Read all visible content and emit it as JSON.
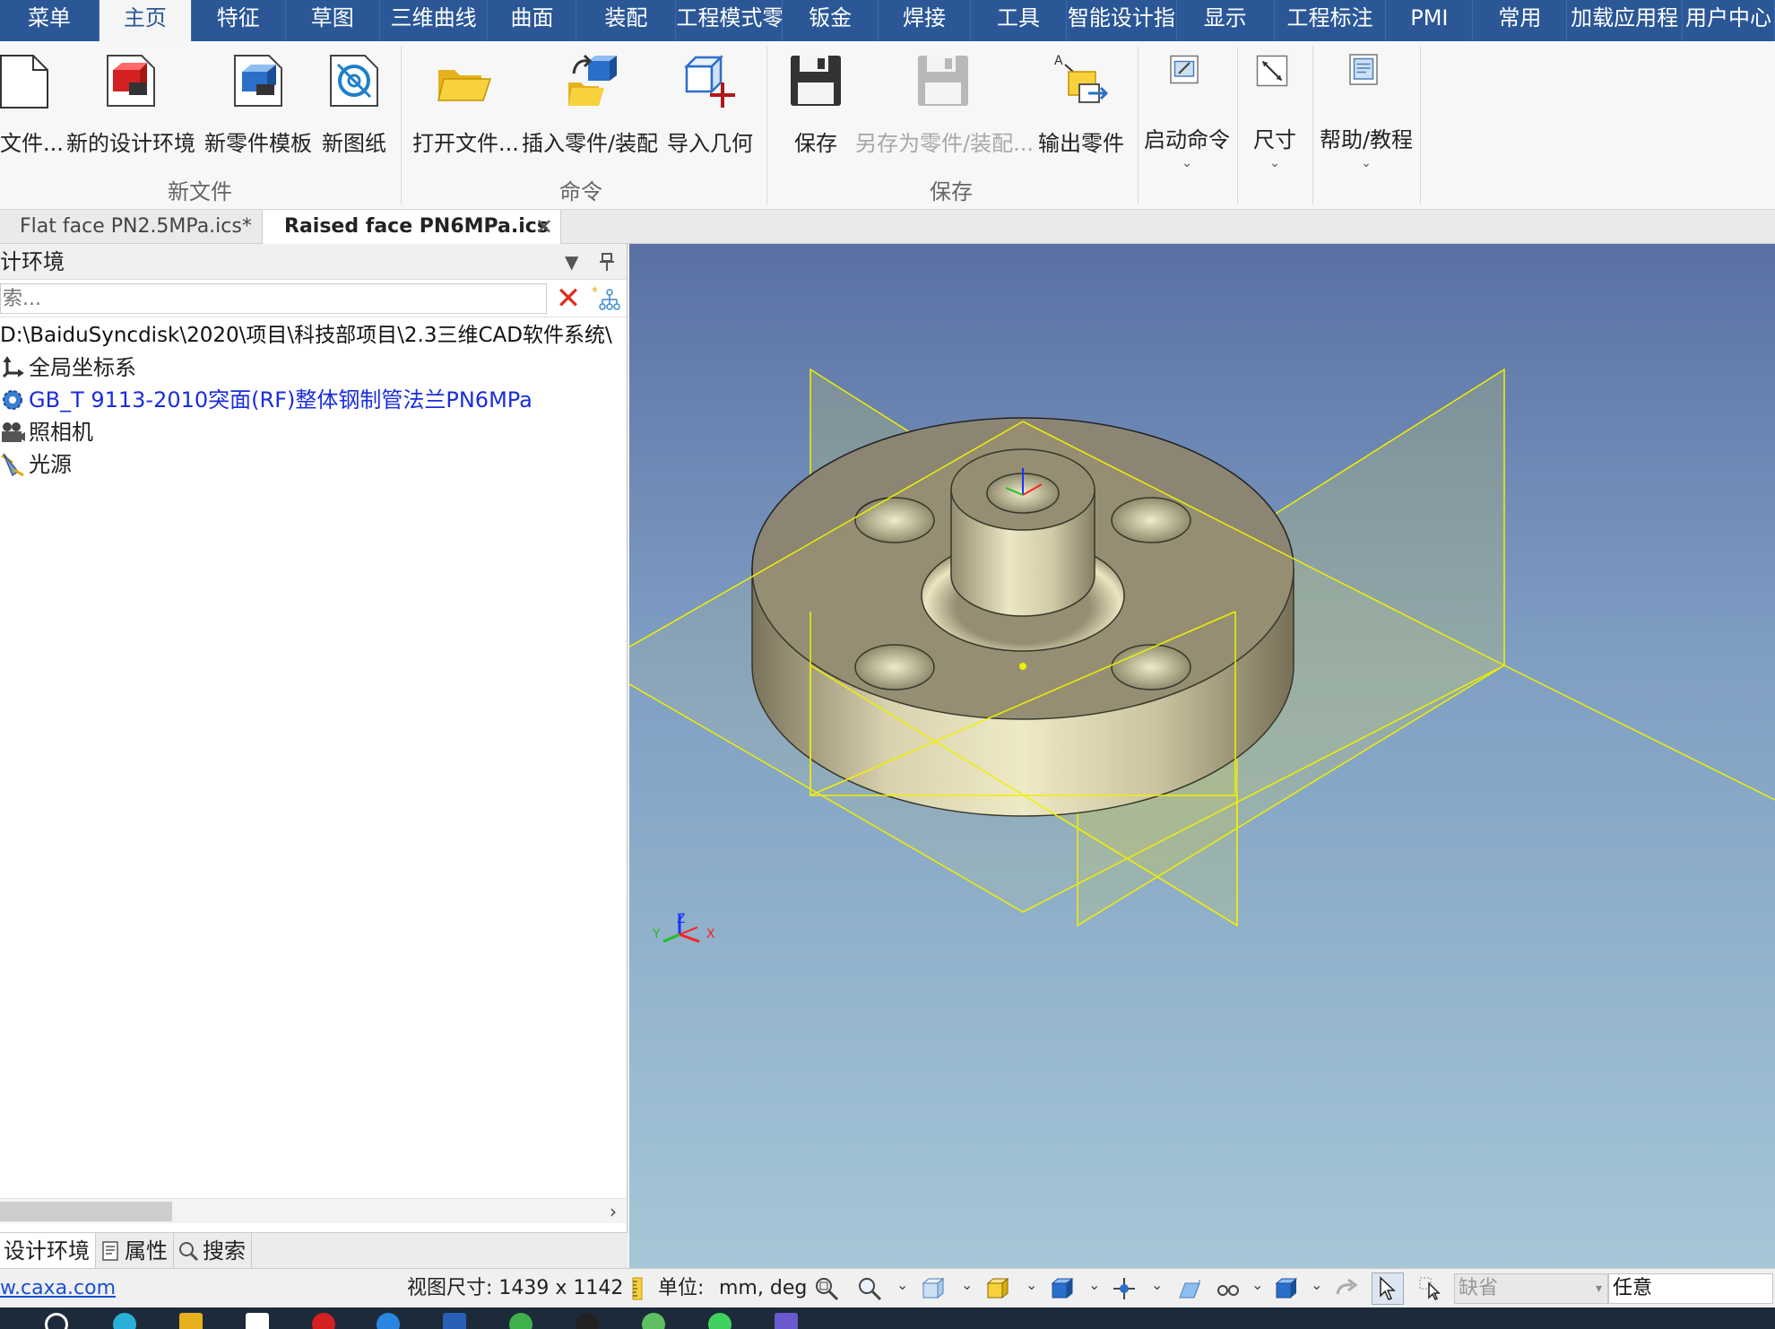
{
  "menubar": {
    "tabs": [
      {
        "label": "菜单",
        "active": false
      },
      {
        "label": "主页",
        "active": true
      },
      {
        "label": "特征",
        "active": false
      },
      {
        "label": "草图",
        "active": false
      },
      {
        "label": "三维曲线",
        "active": false
      },
      {
        "label": "曲面",
        "active": false
      },
      {
        "label": "装配",
        "active": false
      },
      {
        "label": "工程模式零",
        "active": false
      },
      {
        "label": "钣金",
        "active": false
      },
      {
        "label": "焊接",
        "active": false
      },
      {
        "label": "工具",
        "active": false
      },
      {
        "label": "智能设计指",
        "active": false
      },
      {
        "label": "显示",
        "active": false
      },
      {
        "label": "工程标注",
        "active": false
      },
      {
        "label": "PMI",
        "active": false
      },
      {
        "label": "常用",
        "active": false
      },
      {
        "label": "加载应用程",
        "active": false
      },
      {
        "label": "用户中心",
        "active": false
      }
    ]
  },
  "ribbon": {
    "groups": {
      "new_file": "新文件",
      "commands": "命令",
      "save": "保存"
    },
    "buttons": {
      "new_file": "文件...",
      "new_design_env": "新的设计环境",
      "new_part_template": "新零件模板",
      "new_drawing": "新图纸",
      "open_file": "打开文件...",
      "insert_part": "插入零件/装配",
      "import_geometry": "导入几何",
      "save": "保存",
      "save_as_part": "另存为零件/装配...",
      "export_part": "输出零件",
      "start_command": "启动命令",
      "dimension": "尺寸",
      "help": "帮助/教程"
    }
  },
  "doc_tabs": {
    "tab1": "Flat face PN2.5MPa.ics*",
    "tab2": "Raised face PN6MPa.ics",
    "close": "✕"
  },
  "left_panel": {
    "title": "计环境",
    "search_placeholder": "索...",
    "path": "D:\\BaiduSyncdisk\\2020\\项目\\科技部项目\\2.3三维CAD软件系统\\",
    "items": {
      "global_cs": "全局坐标系",
      "part": "GB_T 9113-2010突面(RF)整体钢制管法兰PN6MPa",
      "camera": "照相机",
      "light": "光源"
    },
    "bottom_tabs": {
      "design_env": "设计环境",
      "properties": "属性",
      "search": "搜索"
    }
  },
  "viewport": {
    "axis_z": "Z",
    "axis_x": "X",
    "axis_y": "Y"
  },
  "statusbar": {
    "url": "w.caxa.com",
    "view_size": "视图尺寸: 1439 x 1142",
    "unit_label": "单位:",
    "unit_value": "mm, deg",
    "filter_default": "缺省",
    "filter_any": "任意"
  },
  "colors": {
    "menubar": "#2b5797",
    "accent_red": "#e0301e",
    "link_blue": "#1a2ddb"
  }
}
